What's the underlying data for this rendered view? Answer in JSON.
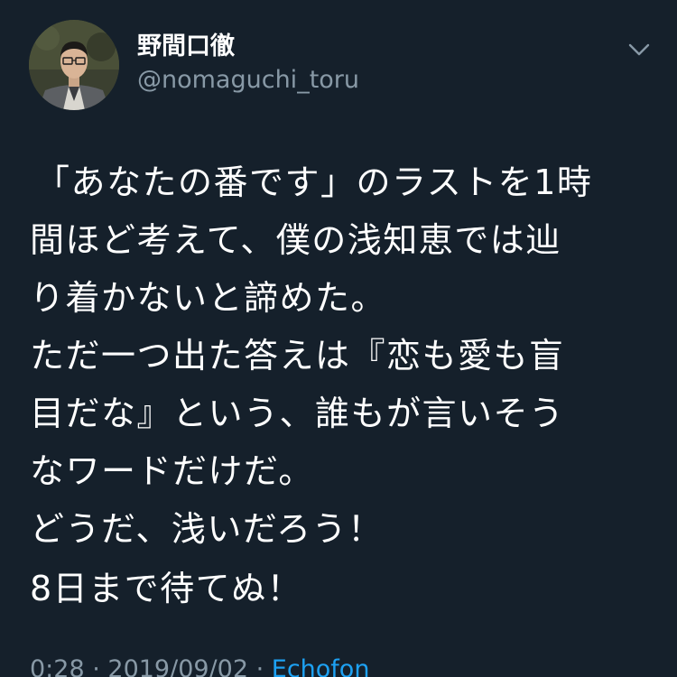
{
  "author": {
    "display_name": "野間口徹",
    "handle": "@nomaguchi_toru",
    "avatar_icon": "profile-photo-icon"
  },
  "menu": {
    "icon": "chevron-down-icon"
  },
  "tweet": {
    "lines": [
      "「あなたの番です」のラストを1時",
      "間ほど考えて、僕の浅知恵では辿",
      "り着かないと諦めた。",
      "ただ一つ出た答えは『恋も愛も盲",
      "目だな』という、誰もが言いそう",
      "なワードだけだ。",
      "どうだ、浅いだろう！"
    ],
    "closing": "8日まで待てぬ！"
  },
  "meta": {
    "time": "0:28",
    "separator1": " · ",
    "date": "2019/09/02",
    "separator2": " · ",
    "source": "Echofon"
  },
  "colors": {
    "background": "#15202b",
    "text": "#ffffff",
    "secondary": "#8899a6",
    "link": "#1da1f2"
  }
}
